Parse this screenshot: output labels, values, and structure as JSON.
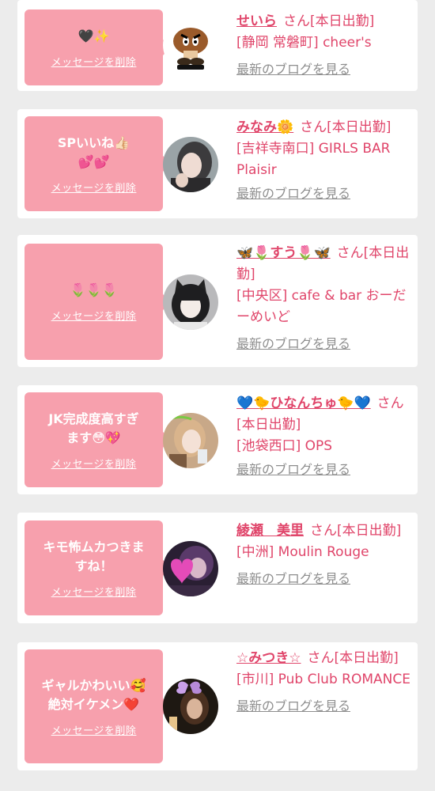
{
  "delete_label": "メッセージを削除",
  "blog_label": "最新のブログを見る",
  "colors": {
    "accent": "#e0456a",
    "bubble": "#f7a0ad",
    "background": "#ececec"
  },
  "cards": [
    {
      "message": "🖤✨",
      "name": "せいら",
      "suffix": "さん[本日出勤]",
      "shop": "[静岡 常磐町] cheer's",
      "avatar": "goomba-figure-avatar"
    },
    {
      "message": "SPいいね👍🏻\n💕💕",
      "name": "みなみ🌼",
      "suffix": "さん[本日出勤]",
      "shop": "[吉祥寺南口] GIRLS BAR Plaisir",
      "avatar": "girl-photo-avatar"
    },
    {
      "message": "🌷🌷🌷",
      "name": "🦋🌷すう🌷🦋",
      "suffix": "さん[本日出勤]",
      "shop": "[中央区] cafe & bar おーだーめいど",
      "avatar": "cat-ear-girl-avatar"
    },
    {
      "message": "JK完成度高すぎ\nます😳💖",
      "name": "💙🐤ひなんちゅ🐤💙",
      "suffix": "さん[本日出勤]",
      "shop": "[池袋西口] OPS",
      "avatar": "girl-drink-avatar"
    },
    {
      "message": "キモ怖ムカつきま\nすね！",
      "name": "綾瀬　美里",
      "suffix": "さん[本日出勤]",
      "shop": "[中洲] Moulin Rouge",
      "avatar": "heart-photo-avatar"
    },
    {
      "message": "ギャルかわいい🥰\n絶対イケメン❤️",
      "name": "☆みつき☆",
      "suffix": "さん[本日出勤]",
      "shop": "[市川] Pub Club ROMANCE",
      "avatar": "butterfly-photo-avatar"
    }
  ]
}
